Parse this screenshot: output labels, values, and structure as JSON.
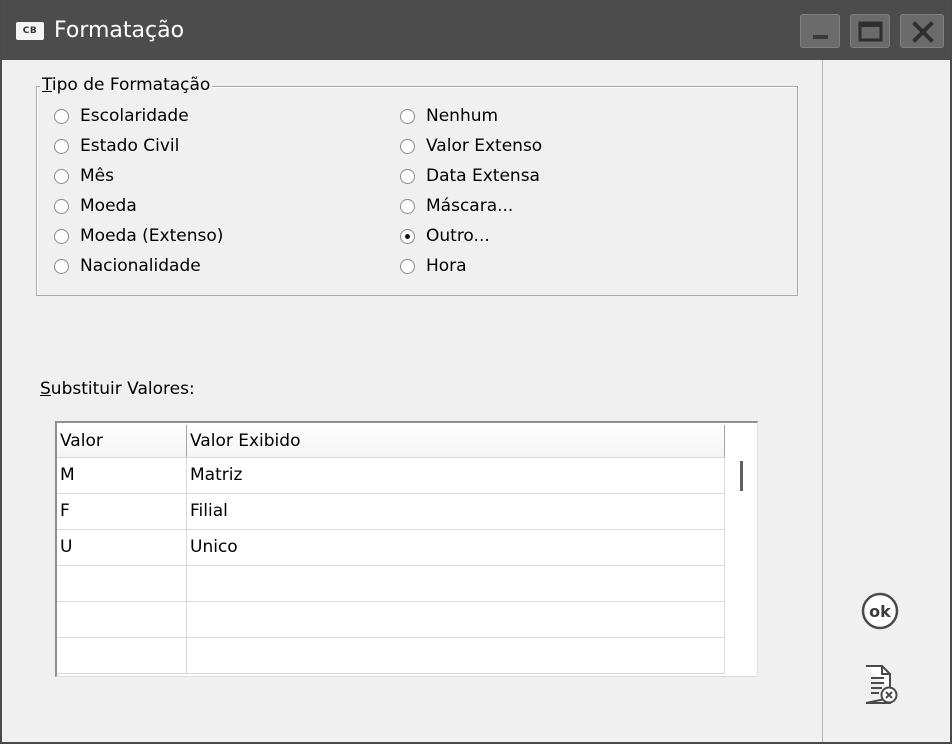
{
  "window": {
    "icon_text": "CB",
    "title": "Formatação"
  },
  "format_group": {
    "legend_accel": "T",
    "legend_rest": "ipo de Formatação",
    "left_options": [
      "Escolaridade",
      "Estado Civil",
      "Mês",
      "Moeda",
      "Moeda (Extenso)",
      "Nacionalidade"
    ],
    "right_options": [
      "Nenhum",
      "Valor Extenso",
      "Data Extensa",
      "Máscara...",
      "Outro...",
      "Hora"
    ],
    "selected": "Outro..."
  },
  "substitute": {
    "label_accel": "S",
    "label_rest": "ubstituir Valores:",
    "columns": [
      "Valor",
      "Valor Exibido"
    ],
    "rows": [
      [
        "M",
        "Matriz"
      ],
      [
        "F",
        "Filial"
      ],
      [
        "U",
        "Unico"
      ],
      [
        "",
        ""
      ],
      [
        "",
        ""
      ],
      [
        "",
        ""
      ]
    ]
  },
  "icons": {
    "app": "app-icon",
    "minimize": "minimize-icon",
    "maximize": "maximize-icon",
    "close": "close-icon",
    "ok": "ok-icon",
    "cancel": "cancel-document-icon"
  },
  "colors": {
    "titlebar": "#4c4c4c",
    "window_bg": "#f0f0f0",
    "grid_bg": "#ffffff"
  }
}
